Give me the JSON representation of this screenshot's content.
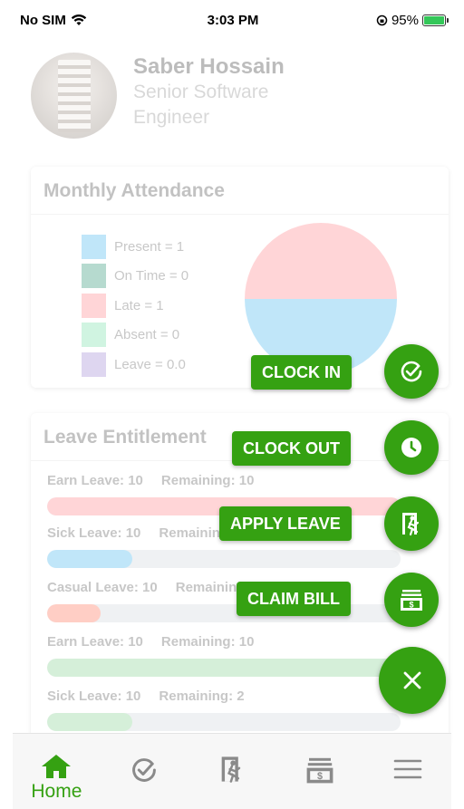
{
  "status_bar": {
    "carrier": "No SIM",
    "time": "3:03 PM",
    "battery": "95%"
  },
  "profile": {
    "name": "Saber Hossain",
    "role": "Senior Software Engineer"
  },
  "attendance": {
    "title": "Monthly Attendance",
    "legend": [
      {
        "label": "Present = 1",
        "color": "#3fb4ef"
      },
      {
        "label": "On Time = 0",
        "color": "#1f8f6d"
      },
      {
        "label": "Late = 1",
        "color": "#ff7f86"
      },
      {
        "label": "Absent = 0",
        "color": "#6fe0a3"
      },
      {
        "label": "Leave = 0.0",
        "color": "#9b83d3"
      }
    ]
  },
  "leave": {
    "title": "Leave Entitlement",
    "rows": [
      {
        "type": "Earn Leave: 10",
        "remaining": "Remaining: 10",
        "fraction": 1.0,
        "color": "#ff7f86"
      },
      {
        "type": "Sick Leave: 10",
        "remaining": "Remaining: 2",
        "fraction": 0.24,
        "color": "#3fb4ef"
      },
      {
        "type": "Casual Leave: 10",
        "remaining": "Remaining: 2",
        "fraction": 0.15,
        "color": "#ff6a4d"
      },
      {
        "type": "Earn Leave: 10",
        "remaining": "Remaining: 10",
        "fraction": 1.0,
        "color": "#7fcf8a"
      },
      {
        "type": "Sick Leave: 10",
        "remaining": "Remaining: 2",
        "fraction": 0.24,
        "color": "#7fcf8a"
      }
    ]
  },
  "fab_actions": {
    "clock_in": "CLOCK IN",
    "clock_out": "CLOCK OUT",
    "apply_leave": "APPLY LEAVE",
    "claim_bill": "CLAIM BILL"
  },
  "tabbar": {
    "home_label": "Home"
  },
  "accent_color": "#35a112"
}
